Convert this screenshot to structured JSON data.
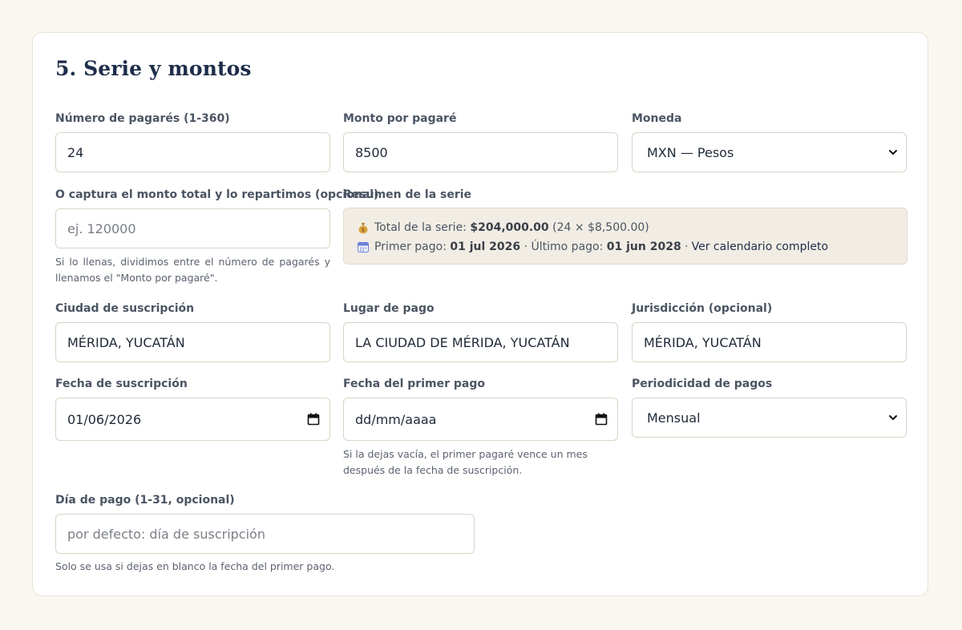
{
  "section": {
    "title": "5. Serie y montos"
  },
  "fields": {
    "num_pagares": {
      "label": "Número de pagarés (1-360)",
      "value": "24"
    },
    "monto_pagare": {
      "label": "Monto por pagaré",
      "value": "8500"
    },
    "moneda": {
      "label": "Moneda",
      "value": "MXN — Pesos"
    },
    "monto_total": {
      "label": "O captura el monto total y lo repartimos (opcional)",
      "placeholder": "ej. 120000",
      "help": "Si lo llenas, dividimos entre el número de pagarés y llenamos el \"Monto por pagaré\"."
    },
    "ciudad": {
      "label": "Ciudad de suscripción",
      "value": "MÉRIDA, YUCATÁN"
    },
    "lugar_pago": {
      "label": "Lugar de pago",
      "value": "LA CIUDAD DE MÉRIDA, YUCATÁN"
    },
    "jurisdiccion": {
      "label": "Jurisdicción (opcional)",
      "value": "MÉRIDA, YUCATÁN"
    },
    "fecha_suscripcion": {
      "label": "Fecha de suscripción",
      "value": "01/06/2026"
    },
    "fecha_primer_pago": {
      "label": "Fecha del primer pago",
      "placeholder": "dd/mm/aaaa",
      "help": "Si la dejas vacía, el primer pagaré vence un mes después de la fecha de suscripción."
    },
    "periodicidad": {
      "label": "Periodicidad de pagos",
      "value": "Mensual"
    },
    "dia_pago": {
      "label": "Día de pago (1-31, opcional)",
      "placeholder": "por defecto: día de suscripción",
      "help": "Solo se usa si dejas en blanco la fecha del primer pago."
    }
  },
  "summary": {
    "label": "Resumen de la serie",
    "total_label": "Total de la serie:",
    "total_value": "$204,000.00",
    "total_detail": "(24 × $8,500.00)",
    "first_label": "Primer pago:",
    "first_value": "01 jul 2026",
    "sep1": "·",
    "last_label": "Último pago:",
    "last_value": "01 jun 2028",
    "sep2": "·",
    "calendar_link": "Ver calendario completo"
  },
  "icons": {
    "money": "money-bag-icon",
    "calendar": "calendar-icon",
    "chevron": "chevron-down-icon"
  },
  "colors": {
    "page_bg": "#faf7f0",
    "title": "#1e2d4a",
    "summary_bg": "#f1ede4",
    "money_bag": "#d9a441",
    "calendar_icon": "#6b7fd6"
  }
}
